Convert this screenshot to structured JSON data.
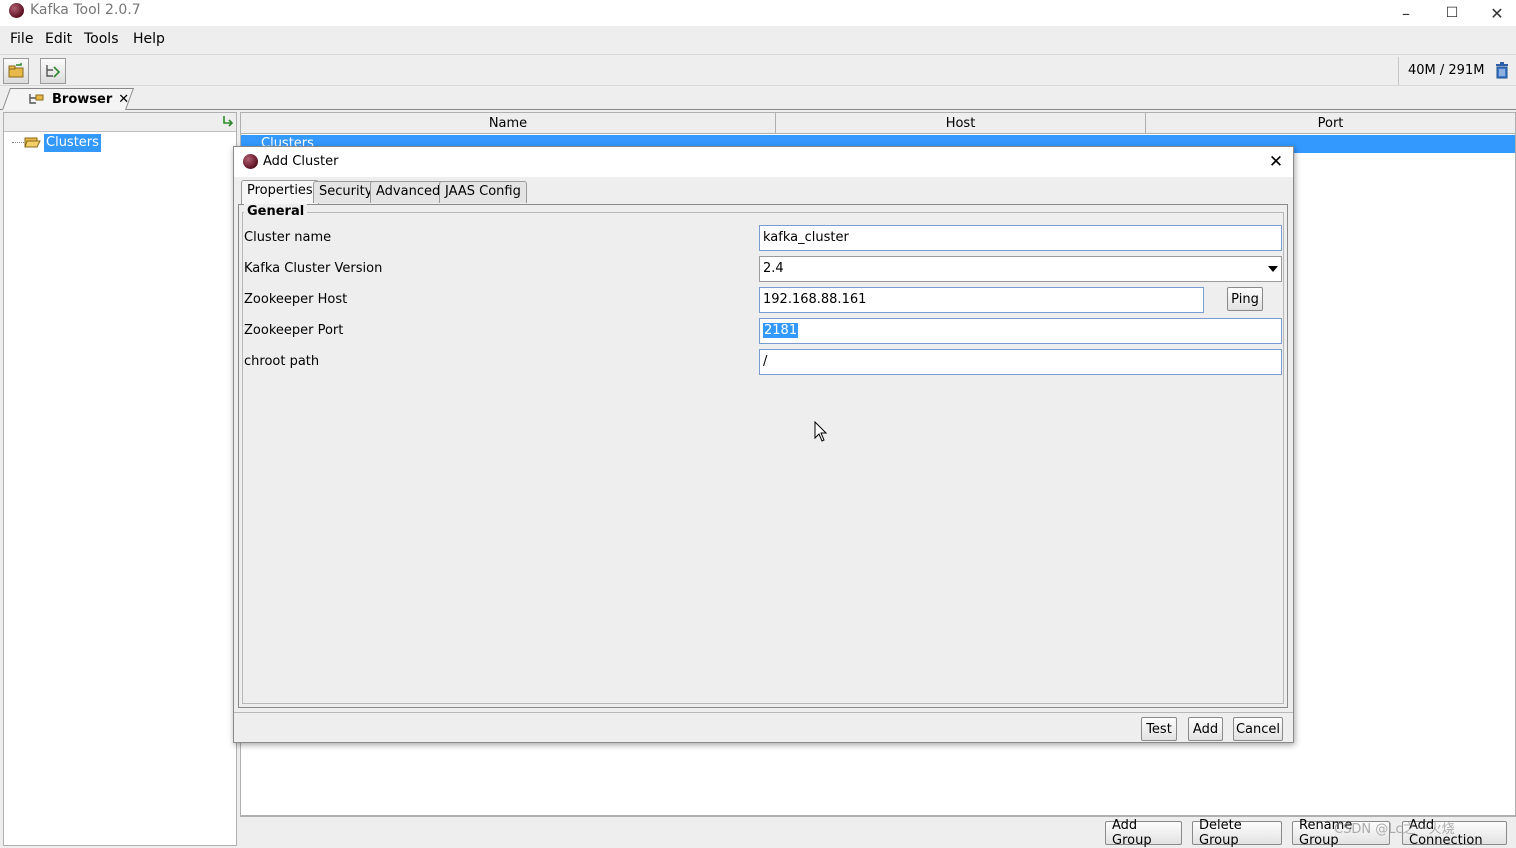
{
  "window": {
    "title": "Kafka Tool  2.0.7",
    "controls": [
      "–",
      "☐",
      "✕"
    ]
  },
  "menu": {
    "file": "File",
    "edit": "Edit",
    "tools": "Tools",
    "help": "Help"
  },
  "toolbar": {
    "memory": "40M / 291M"
  },
  "browser_tab": {
    "label": "Browser",
    "close": "✕"
  },
  "tree": {
    "root": "Clusters"
  },
  "table": {
    "columns": [
      "Name",
      "Host",
      "Port"
    ],
    "selected_row": "Clusters"
  },
  "bottom_buttons": {
    "add_group": "Add Group",
    "delete_group": "Delete Group",
    "rename_group": "Rename Group",
    "add_connection": "Add Connection"
  },
  "dialog": {
    "title": "Add Cluster",
    "close": "✕",
    "tabs": [
      "Properties",
      "Security",
      "Advanced",
      "JAAS Config"
    ],
    "active_tab": "Properties",
    "section": "General",
    "fields": {
      "cluster_name": {
        "label": "Cluster name",
        "value": "kafka_cluster"
      },
      "kafka_version": {
        "label": "Kafka Cluster Version",
        "value": "2.4"
      },
      "zk_host": {
        "label": "Zookeeper Host",
        "value": "192.168.88.161"
      },
      "zk_port": {
        "label": "Zookeeper Port",
        "value": "2181"
      },
      "chroot": {
        "label": "chroot path",
        "value": "/"
      }
    },
    "ping_label": "Ping",
    "buttons": {
      "test": "Test",
      "add": "Add",
      "cancel": "Cancel"
    }
  },
  "watermark": "CSDN @Lc之一火烧"
}
